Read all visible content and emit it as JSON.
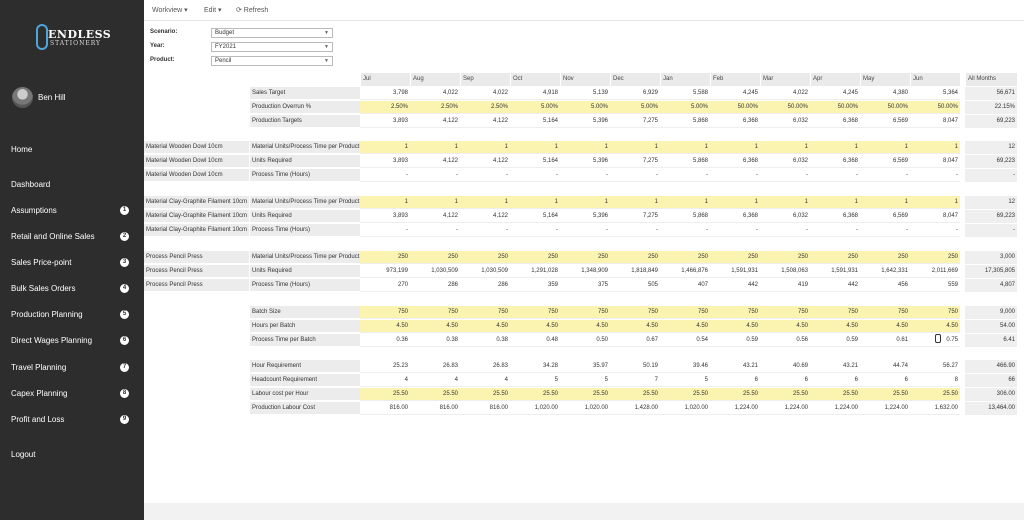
{
  "brand": {
    "line1": "ENDLESS",
    "line2": "STATIONERY"
  },
  "user": {
    "name": "Ben Hill"
  },
  "nav": [
    {
      "label": "Home",
      "badge": ""
    },
    {
      "label": "Dashboard",
      "badge": ""
    },
    {
      "label": "Assumptions",
      "badge": "1"
    },
    {
      "label": "Retail and Online Sales",
      "badge": "2"
    },
    {
      "label": "Sales Price-point",
      "badge": "3"
    },
    {
      "label": "Bulk Sales Orders",
      "badge": "4"
    },
    {
      "label": "Production Planning",
      "badge": "5"
    },
    {
      "label": "Direct Wages Planning",
      "badge": "6"
    },
    {
      "label": "Travel Planning",
      "badge": "7"
    },
    {
      "label": "Capex Planning",
      "badge": "8"
    },
    {
      "label": "Profit and Loss",
      "badge": "9"
    },
    {
      "label": "Logout",
      "badge": ""
    }
  ],
  "toolbar": {
    "workview": "Workview ▾",
    "edit": "Edit ▾",
    "refresh": "⟳ Refresh"
  },
  "filters": [
    {
      "label": "Scenario:",
      "value": "Budget"
    },
    {
      "label": "Year:",
      "value": "FY2021"
    },
    {
      "label": "Product:",
      "value": "Pencil"
    }
  ],
  "months": [
    "Jul",
    "Aug",
    "Sep",
    "Oct",
    "Nov",
    "Dec",
    "Jan",
    "Feb",
    "Mar",
    "Apr",
    "May",
    "Jun"
  ],
  "total_header": "All Months",
  "rows": [
    {
      "r": "",
      "m": "Sales Target",
      "y": false,
      "v": [
        "3,798",
        "4,022",
        "4,022",
        "4,918",
        "5,139",
        "6,929",
        "5,588",
        "4,245",
        "4,022",
        "4,245",
        "4,380",
        "5,364"
      ],
      "t": "56,671"
    },
    {
      "r": "",
      "m": "Production Overrun %",
      "y": true,
      "v": [
        "2.50%",
        "2.50%",
        "2.50%",
        "5.00%",
        "5.00%",
        "5.00%",
        "5.00%",
        "50.00%",
        "50.00%",
        "50.00%",
        "50.00%",
        "50.00%"
      ],
      "t": "22.15%"
    },
    {
      "r": "",
      "m": "Production Targets",
      "y": false,
      "v": [
        "3,893",
        "4,122",
        "4,122",
        "5,164",
        "5,396",
        "7,275",
        "5,868",
        "6,368",
        "6,032",
        "6,368",
        "6,569",
        "8,047"
      ],
      "t": "69,223"
    },
    {
      "r": "Material Wooden Dowl 10cm",
      "m": "Material Units/Process Time per Product",
      "y": true,
      "v": [
        "1",
        "1",
        "1",
        "1",
        "1",
        "1",
        "1",
        "1",
        "1",
        "1",
        "1",
        "1"
      ],
      "t": "12"
    },
    {
      "r": "Material Wooden Dowl 10cm",
      "m": "Units Required",
      "y": false,
      "v": [
        "3,893",
        "4,122",
        "4,122",
        "5,164",
        "5,396",
        "7,275",
        "5,868",
        "6,368",
        "6,032",
        "6,368",
        "6,569",
        "8,047"
      ],
      "t": "69,223"
    },
    {
      "r": "Material Wooden Dowl 10cm",
      "m": "Process Time (Hours)",
      "y": false,
      "v": [
        "-",
        "-",
        "-",
        "-",
        "-",
        "-",
        "-",
        "-",
        "-",
        "-",
        "-",
        "-"
      ],
      "t": "-"
    },
    {
      "r": "Material Clay-Graphite Filament 10cm",
      "m": "Material Units/Process Time per Product",
      "y": true,
      "v": [
        "1",
        "1",
        "1",
        "1",
        "1",
        "1",
        "1",
        "1",
        "1",
        "1",
        "1",
        "1"
      ],
      "t": "12"
    },
    {
      "r": "Material Clay-Graphite Filament 10cm",
      "m": "Units Required",
      "y": false,
      "v": [
        "3,893",
        "4,122",
        "4,122",
        "5,164",
        "5,396",
        "7,275",
        "5,868",
        "6,368",
        "6,032",
        "6,368",
        "6,569",
        "8,047"
      ],
      "t": "69,223"
    },
    {
      "r": "Material Clay-Graphite Filament 10cm",
      "m": "Process Time (Hours)",
      "y": false,
      "v": [
        "-",
        "-",
        "-",
        "-",
        "-",
        "-",
        "-",
        "-",
        "-",
        "-",
        "-",
        "-"
      ],
      "t": "-"
    },
    {
      "r": "Process Pencil Press",
      "m": "Material Units/Process Time per Product",
      "y": true,
      "v": [
        "250",
        "250",
        "250",
        "250",
        "250",
        "250",
        "250",
        "250",
        "250",
        "250",
        "250",
        "250"
      ],
      "t": "3,000"
    },
    {
      "r": "Process Pencil Press",
      "m": "Units Required",
      "y": false,
      "v": [
        "973,199",
        "1,030,509",
        "1,030,509",
        "1,291,028",
        "1,348,909",
        "1,818,849",
        "1,466,876",
        "1,591,931",
        "1,508,063",
        "1,591,931",
        "1,642,331",
        "2,011,669"
      ],
      "t": "17,305,805"
    },
    {
      "r": "Process Pencil Press",
      "m": "Process Time (Hours)",
      "y": false,
      "v": [
        "270",
        "286",
        "286",
        "359",
        "375",
        "505",
        "407",
        "442",
        "419",
        "442",
        "456",
        "559"
      ],
      "t": "4,807"
    },
    {
      "r": "",
      "m": "Batch Size",
      "y": true,
      "v": [
        "750",
        "750",
        "750",
        "750",
        "750",
        "750",
        "750",
        "750",
        "750",
        "750",
        "750",
        "750"
      ],
      "t": "9,000"
    },
    {
      "r": "",
      "m": "Hours per Batch",
      "y": true,
      "v": [
        "4.50",
        "4.50",
        "4.50",
        "4.50",
        "4.50",
        "4.50",
        "4.50",
        "4.50",
        "4.50",
        "4.50",
        "4.50",
        "4.50"
      ],
      "t": "54.00"
    },
    {
      "r": "",
      "m": "Process Time per Batch",
      "y": false,
      "v": [
        "0.36",
        "0.38",
        "0.38",
        "0.48",
        "0.50",
        "0.67",
        "0.54",
        "0.59",
        "0.56",
        "0.59",
        "0.61",
        "0.75"
      ],
      "t": "6.41"
    },
    {
      "r": "",
      "m": "Hour Requirement",
      "y": false,
      "v": [
        "25.23",
        "26.83",
        "26.83",
        "34.28",
        "35.97",
        "50.19",
        "39.46",
        "43.21",
        "40.69",
        "43.21",
        "44.74",
        "56.27"
      ],
      "t": "466.90"
    },
    {
      "r": "",
      "m": "Headcount Requirement",
      "y": false,
      "v": [
        "4",
        "4",
        "4",
        "5",
        "5",
        "7",
        "5",
        "6",
        "6",
        "6",
        "6",
        "8"
      ],
      "t": "66"
    },
    {
      "r": "",
      "m": "Labour cost per Hour",
      "y": true,
      "v": [
        "25.50",
        "25.50",
        "25.50",
        "25.50",
        "25.50",
        "25.50",
        "25.50",
        "25.50",
        "25.50",
        "25.50",
        "25.50",
        "25.50"
      ],
      "t": "306.00"
    },
    {
      "r": "",
      "m": "Production Labour Cost",
      "y": false,
      "v": [
        "816.00",
        "816.00",
        "816.00",
        "1,020.00",
        "1,020.00",
        "1,428.00",
        "1,020.00",
        "1,224.00",
        "1,224.00",
        "1,224.00",
        "1,224.00",
        "1,632.00"
      ],
      "t": "13,464.00"
    }
  ]
}
